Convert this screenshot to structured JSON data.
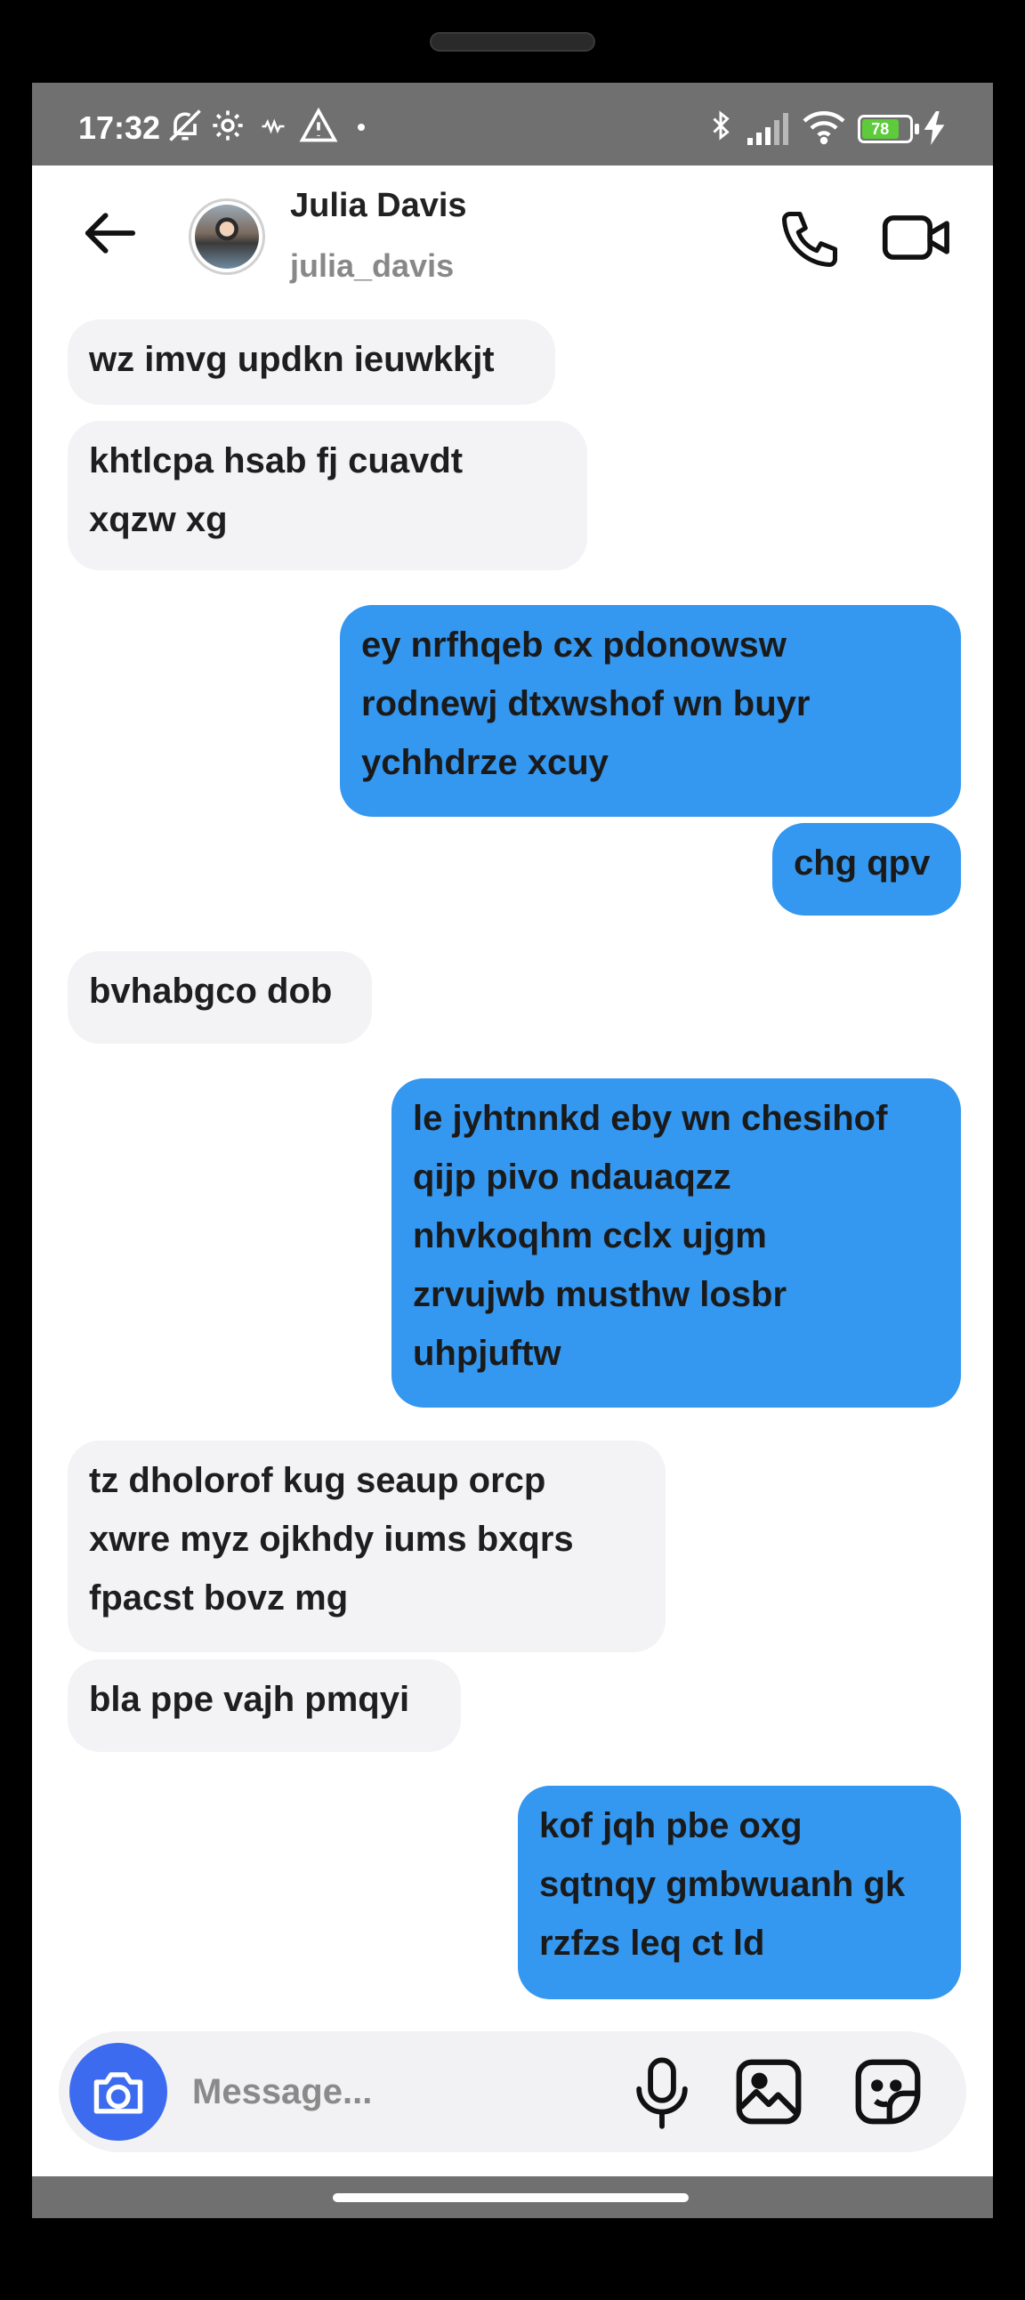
{
  "status_bar": {
    "time": "17:32",
    "battery_level": "78"
  },
  "header": {
    "contact_name": "Julia Davis",
    "contact_username": "julia_davis"
  },
  "messages": [
    {
      "direction": "incoming",
      "text": "wz imvg updkn ieuwkkjt"
    },
    {
      "direction": "incoming",
      "text": "khtlcpa hsab fj cuavdt\nxqzw xg"
    },
    {
      "direction": "outgoing",
      "text": "ey nrfhqeb cx pdonowsw\nrodnewj dtxwshof wn buyr\nychhdrze xcuy"
    },
    {
      "direction": "outgoing",
      "text": "chg qpv"
    },
    {
      "direction": "incoming",
      "text": "bvhabgco dob"
    },
    {
      "direction": "outgoing",
      "text": "le jyhtnnkd eby wn chesihof\nqijp pivo ndauaqzz\nnhvkoqhm cclx ujgm\nzrvujwb musthw losbr\nuhpjuftw"
    },
    {
      "direction": "incoming",
      "text": "tz dholorof kug seaup orcp\nxwre myz ojkhdy iums bxqrs\nfpacst bovz mg"
    },
    {
      "direction": "incoming",
      "text": "bla ppe vajh pmqyi"
    },
    {
      "direction": "outgoing",
      "text": "kof jqh pbe oxg\nsqtnqy gmbwuanh gk\nrzfzs leq ct ld"
    }
  ],
  "composer": {
    "placeholder": "Message..."
  },
  "colors": {
    "outgoing_bubble": "#3497f0",
    "incoming_bubble": "#f3f3f6",
    "camera_button": "#3c6bf0"
  },
  "icons": [
    "back-arrow-icon",
    "phone-icon",
    "video-camera-icon",
    "camera-icon",
    "microphone-icon",
    "image-icon",
    "sticker-icon"
  ]
}
